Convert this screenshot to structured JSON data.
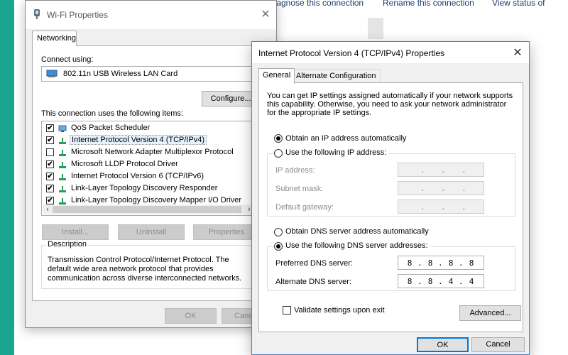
{
  "background_window": {
    "commands": [
      "Diagnose this connection",
      "Rename this connection",
      "View status of"
    ]
  },
  "wifi_dialog": {
    "title": "Wi-Fi Properties",
    "close_glyph": "✕",
    "tab": "Networking",
    "connect_using_label": "Connect using:",
    "adapter": "802.11n USB Wireless LAN Card",
    "configure_label": "Configure...",
    "items_label": "This connection uses the following items:",
    "items": [
      {
        "label": "QoS Packet Scheduler",
        "checked": true
      },
      {
        "label": "Internet Protocol Version 4 (TCP/IPv4)",
        "checked": true,
        "selected": true
      },
      {
        "label": "Microsoft Network Adapter Multiplexor Protocol",
        "checked": false
      },
      {
        "label": "Microsoft LLDP Protocol Driver",
        "checked": true
      },
      {
        "label": "Internet Protocol Version 6 (TCP/IPv6)",
        "checked": true
      },
      {
        "label": "Link-Layer Topology Discovery Responder",
        "checked": true
      },
      {
        "label": "Link-Layer Topology Discovery Mapper I/O Driver",
        "checked": true
      }
    ],
    "check_glyph": "✔",
    "scroll_left": "‹",
    "scroll_right": "›",
    "install_label": "Install...",
    "uninstall_label": "Uninstall",
    "properties_label": "Properties",
    "description_label": "Description",
    "description_text": "Transmission Control Protocol/Internet Protocol. The default wide area network protocol that provides communication across diverse interconnected networks.",
    "ok_label": "OK",
    "cancel_label": "Cance"
  },
  "ipv4_dialog": {
    "title": "Internet Protocol Version 4 (TCP/IPv4) Properties",
    "close_glyph": "✕",
    "tabs": [
      "General",
      "Alternate Configuration"
    ],
    "intro": "You can get IP settings assigned automatically if your network supports this capability. Otherwise, you need to ask your network administrator for the appropriate IP settings.",
    "obtain_ip_auto": "Obtain an IP address automatically",
    "use_following_ip": "Use the following IP address:",
    "ip_address_label": "IP address:",
    "subnet_mask_label": "Subnet mask:",
    "default_gateway_label": "Default gateway:",
    "obtain_dns_auto": "Obtain DNS server address automatically",
    "use_following_dns": "Use the following DNS server addresses:",
    "preferred_dns_label": "Preferred DNS server:",
    "alternate_dns_label": "Alternate DNS server:",
    "preferred_dns": [
      "8",
      "8",
      "8",
      "8"
    ],
    "alternate_dns": [
      "8",
      "8",
      "4",
      "4"
    ],
    "ip_separator": ".",
    "validate_label": "Validate settings upon exit",
    "advanced_label": "Advanced...",
    "ok_label": "OK",
    "cancel_label": "Cancel",
    "ip_mode": "automatic",
    "dns_mode": "manual",
    "validate_checked": false
  },
  "colors": {
    "desktop": "#1aa58e",
    "focus_border": "#0078d7",
    "link_text": "#1e3a6e"
  }
}
